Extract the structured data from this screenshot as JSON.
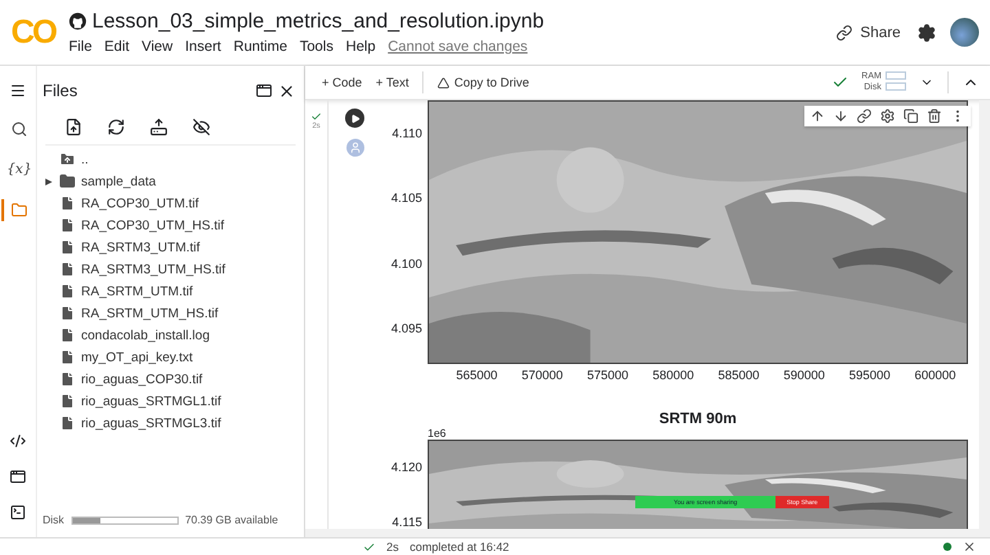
{
  "app": {
    "logo": "CO",
    "title": "Lesson_03_simple_metrics_and_resolution.ipynb",
    "menu": [
      "File",
      "Edit",
      "View",
      "Insert",
      "Runtime",
      "Tools",
      "Help"
    ],
    "save_notice": "Cannot save changes",
    "share": "Share"
  },
  "toolbar": {
    "add_code": "+ Code",
    "add_text": "+ Text",
    "copy_to_drive": "Copy to Drive",
    "ram_label": "RAM",
    "disk_label": "Disk",
    "connected": true
  },
  "rail": [
    {
      "kind": "search",
      "selected": false
    },
    {
      "kind": "variables",
      "label": "{x}",
      "selected": false
    },
    {
      "kind": "files",
      "selected": true
    }
  ],
  "files": {
    "title": "Files",
    "tree": [
      {
        "kind": "parent",
        "name": ".."
      },
      {
        "kind": "folder",
        "name": "sample_data",
        "expanded": false
      },
      {
        "kind": "file",
        "name": "RA_COP30_UTM.tif"
      },
      {
        "kind": "file",
        "name": "RA_COP30_UTM_HS.tif"
      },
      {
        "kind": "file",
        "name": "RA_SRTM3_UTM.tif"
      },
      {
        "kind": "file",
        "name": "RA_SRTM3_UTM_HS.tif"
      },
      {
        "kind": "file",
        "name": "RA_SRTM_UTM.tif"
      },
      {
        "kind": "file",
        "name": "RA_SRTM_UTM_HS.tif"
      },
      {
        "kind": "file",
        "name": "condacolab_install.log"
      },
      {
        "kind": "file",
        "name": "my_OT_api_key.txt"
      },
      {
        "kind": "file",
        "name": "rio_aguas_COP30.tif"
      },
      {
        "kind": "file",
        "name": "rio_aguas_SRTMGL1.tif"
      },
      {
        "kind": "file",
        "name": "rio_aguas_SRTMGL3.tif"
      }
    ],
    "disk": {
      "label": "Disk",
      "level": 0.27,
      "available": "70.39 GB available"
    }
  },
  "cell": {
    "done": true,
    "time": "2s",
    "plots": [
      {
        "yticks": [
          "4.110",
          "4.105",
          "4.100",
          "4.095"
        ],
        "xticks": [
          "565000",
          "570000",
          "575000",
          "580000",
          "585000",
          "590000",
          "595000",
          "600000"
        ]
      },
      {
        "title": "SRTM 90m",
        "offset": "1e6",
        "yticks": [
          "4.120",
          "4.115"
        ]
      }
    ]
  },
  "screen_share": {
    "message": "You are screen sharing",
    "stop": "Stop Share"
  },
  "status_bar": {
    "time": "2s",
    "message": "completed at 16:42"
  }
}
